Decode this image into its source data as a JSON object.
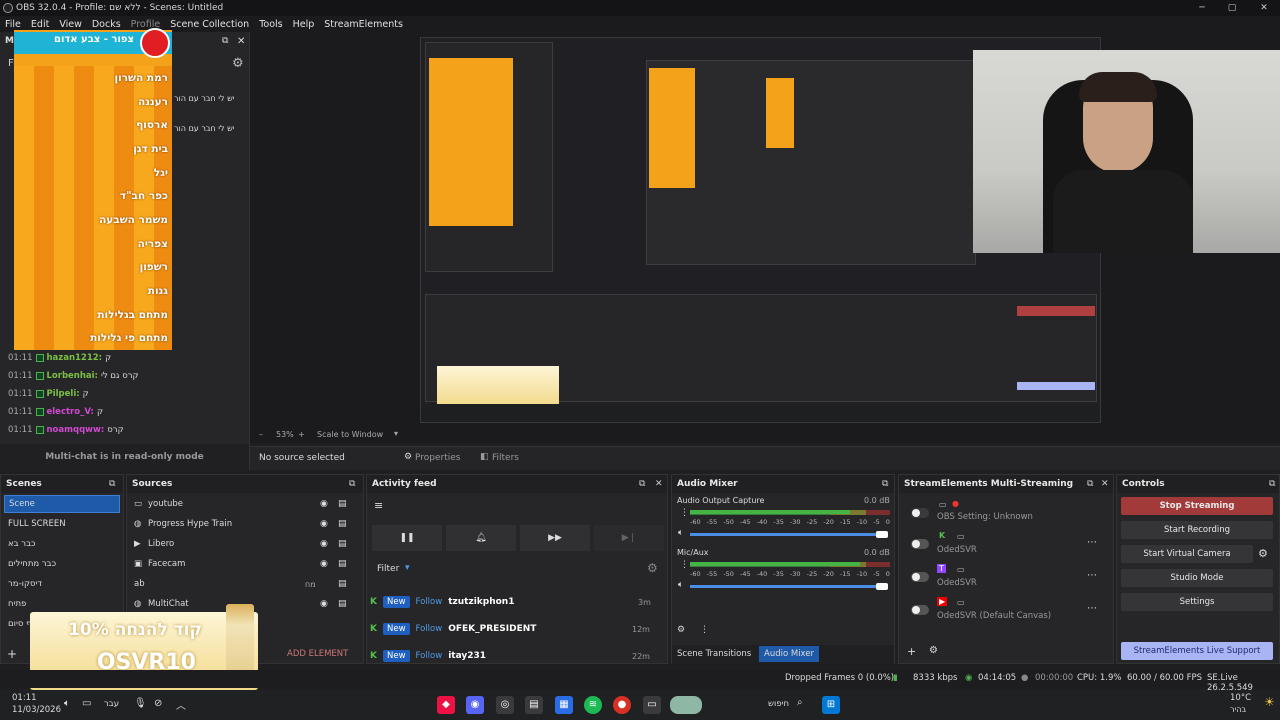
{
  "window": {
    "title": "OBS 32.0.4 - Profile: ללא שם - Scenes: Untitled",
    "min": "─",
    "max": "▢",
    "close": "✕"
  },
  "menu": [
    "File",
    "Edit",
    "View",
    "Docks",
    "Profile",
    "Scene Collection",
    "Tools",
    "Help",
    "StreamElements"
  ],
  "chat": {
    "dock_letter": "M",
    "filter": "Filter",
    "read_only": "Multi-chat is in read-only mode",
    "side_texts": [
      "יש לי חבר עם הור",
      "יש לי חבר עם הור"
    ],
    "messages": [
      {
        "time": "01:11",
        "user": "hazan1212:",
        "text": "ק"
      },
      {
        "time": "01:11",
        "user": "Lorbenhai:",
        "text": "קרס גם לי"
      },
      {
        "time": "01:11",
        "user": "Pilpeli:",
        "text": "ק"
      },
      {
        "time": "01:11",
        "user": "electro_V:",
        "text": "ק"
      },
      {
        "time": "01:11",
        "user": "noamqqww:",
        "text": "קרס"
      }
    ]
  },
  "overlay_list": {
    "title": "צפור - צבע אדום",
    "items": [
      "רמת השרון",
      "רעננה",
      "ארסוף",
      "בית דגן",
      "יגל",
      "כפר חב\"ד",
      "משמר השבעה",
      "צפריה",
      "רשפון",
      "גנות",
      "מתחם בגלילות",
      "מתחם פי גלילות"
    ]
  },
  "preview_bar": {
    "zoom": "53%",
    "scale": "Scale to Window"
  },
  "source_bar": {
    "no_source": "No source selected",
    "properties": "Properties",
    "filters": "Filters"
  },
  "scenes": {
    "title": "Scenes",
    "items": [
      "Scene",
      "FULL SCREEN",
      "כבר בא",
      "כבר מתחילים",
      "דיסקו-מר",
      "פתיח",
      "סוף סיום"
    ]
  },
  "sources": {
    "title": "Sources",
    "items": [
      {
        "name": "youtube",
        "icon": "window-icon"
      },
      {
        "name": "Progress Hype Train",
        "icon": "globe-icon"
      },
      {
        "name": "Libero",
        "icon": "play-icon"
      },
      {
        "name": "Facecam",
        "icon": "camera-icon"
      },
      {
        "name": "",
        "icon": "ab-icon",
        "tag": "ab",
        "extra": "מח"
      },
      {
        "name": "MultiChat",
        "icon": "globe-icon"
      }
    ],
    "add_element": "ADD ELEMENT"
  },
  "activity": {
    "title": "Activity feed",
    "filter": "Filter",
    "rows": [
      {
        "badge": "New",
        "type": "Follow",
        "name": "tzutzikphon1",
        "ago": "3m"
      },
      {
        "badge": "New",
        "type": "Follow",
        "name": "OFEK_PRESIDENT",
        "ago": "12m"
      },
      {
        "badge": "New",
        "type": "Follow",
        "name": "itay231",
        "ago": "22m"
      }
    ]
  },
  "audio": {
    "title": "Audio Mixer",
    "channels": [
      {
        "name": "Audio Output Capture",
        "db": "0.0 dB",
        "level": 0.8
      },
      {
        "name": "Mic/Aux",
        "db": "0.0 dB",
        "level": 0.85
      }
    ],
    "scale": [
      "-60",
      "-55",
      "-50",
      "-45",
      "-40",
      "-35",
      "-30",
      "-25",
      "-20",
      "-15",
      "-10",
      "-5",
      "0"
    ],
    "tabs": [
      "Scene Transitions",
      "Audio Mixer"
    ]
  },
  "multistream": {
    "title": "StreamElements Multi-Streaming",
    "rows": [
      {
        "label": "OBS Setting: Unknown",
        "sub": ""
      },
      {
        "label": "OdedSVR",
        "sub": ""
      },
      {
        "label": "OdedSVR",
        "sub": ""
      },
      {
        "label": "OdedSVR (Default Canvas)",
        "sub": ""
      }
    ]
  },
  "controls": {
    "title": "Controls",
    "stop": "Stop Streaming",
    "record": "Start Recording",
    "vcam": "Start Virtual Camera",
    "studio": "Studio Mode",
    "settings": "Settings",
    "live_support": "StreamElements Live Support"
  },
  "ad": {
    "line1": "קוד להנחה 10%",
    "line2": "OSVR10"
  },
  "status": {
    "dropped": "Dropped Frames 0 (0.0%)",
    "kbps": "8333 kbps",
    "live": "04:14:05",
    "rec": "00:00:00",
    "cpu": "CPU: 1.9%",
    "fps": "60.00 / 60.00 FPS",
    "version": "SE.Live 26.2.5.549"
  },
  "taskbar": {
    "time": "01:11",
    "date": "11/03/2026",
    "lang": "עבר",
    "search": "חיפוש",
    "temp": "10°C",
    "weather": "בהיר"
  },
  "colors": {
    "accent": "#1e5aa8",
    "stop": "#b04040",
    "brand_orange": "#f4a21a",
    "live_support": "#a9b4f5"
  }
}
